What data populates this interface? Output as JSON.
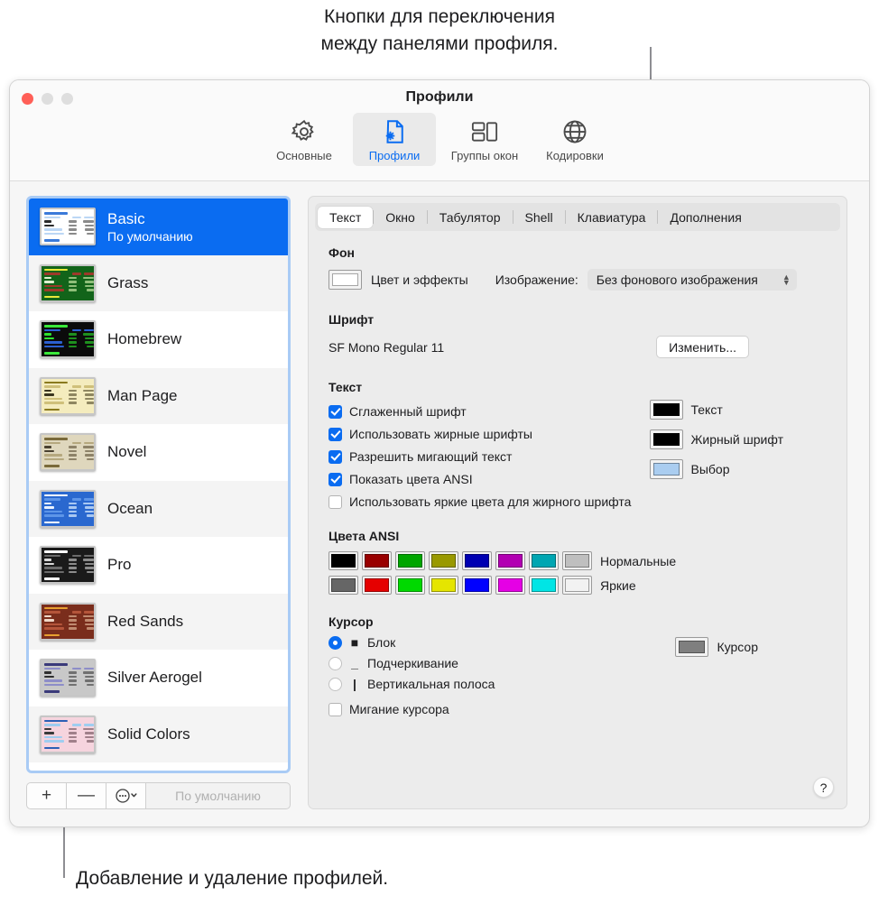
{
  "callouts": {
    "top": "Кнопки для переключения\nмежду панелями профиля.",
    "bottom": "Добавление и удаление профилей."
  },
  "window": {
    "title": "Профили",
    "traffic": {
      "close": "close-button",
      "minimize": "minimize-button",
      "zoom": "zoom-button"
    }
  },
  "toolbar": {
    "items": [
      {
        "label": "Основные",
        "icon": "gear-icon",
        "selected": false
      },
      {
        "label": "Профили",
        "icon": "document-gear-icon",
        "selected": true
      },
      {
        "label": "Группы окон",
        "icon": "window-groups-icon",
        "selected": false
      },
      {
        "label": "Кодировки",
        "icon": "globe-icon",
        "selected": false
      }
    ]
  },
  "sidebar": {
    "profiles": [
      {
        "name": "Basic",
        "subtitle": "По умолчанию",
        "selected": true,
        "theme": {
          "bg": "#ffffff",
          "fg": "#2b2b2b",
          "accent": "#3b7ad9",
          "hl": "#bcd7f5",
          "dim": "#8a8a8a"
        }
      },
      {
        "name": "Grass",
        "subtitle": "",
        "selected": false,
        "theme": {
          "bg": "#12641a",
          "fg": "#dff0cf",
          "accent": "#e8e83a",
          "hl": "#9c3a2a",
          "dim": "#8fbf7a"
        }
      },
      {
        "name": "Homebrew",
        "subtitle": "",
        "selected": false,
        "theme": {
          "bg": "#0b0b0b",
          "fg": "#2ee32e",
          "accent": "#3ae83a",
          "hl": "#2b5fd0",
          "dim": "#1e8f1e"
        }
      },
      {
        "name": "Man Page",
        "subtitle": "",
        "selected": false,
        "theme": {
          "bg": "#f4ecbe",
          "fg": "#3a3520",
          "accent": "#8a7a1e",
          "hl": "#cfc07a",
          "dim": "#8e8660"
        }
      },
      {
        "name": "Novel",
        "subtitle": "",
        "selected": false,
        "theme": {
          "bg": "#dfd7bd",
          "fg": "#4a4130",
          "accent": "#7a6a3a",
          "hl": "#b5a87e",
          "dim": "#8d8268"
        }
      },
      {
        "name": "Ocean",
        "subtitle": "",
        "selected": false,
        "theme": {
          "bg": "#2a68cf",
          "fg": "#eaf2ff",
          "accent": "#ffffff",
          "hl": "#5d95e8",
          "dim": "#a9c8f2"
        }
      },
      {
        "name": "Pro",
        "subtitle": "",
        "selected": false,
        "theme": {
          "bg": "#1a1a1a",
          "fg": "#d8d8d8",
          "accent": "#ffffff",
          "hl": "#6b6b6b",
          "dim": "#8c8c8c"
        }
      },
      {
        "name": "Red Sands",
        "subtitle": "",
        "selected": false,
        "theme": {
          "bg": "#7a2d1c",
          "fg": "#f0d8c8",
          "accent": "#e8a030",
          "hl": "#b5553a",
          "dim": "#c08a70"
        }
      },
      {
        "name": "Silver Aerogel",
        "subtitle": "",
        "selected": false,
        "theme": {
          "bg": "#c8c8c8",
          "fg": "#2f2f2f",
          "accent": "#3a3a7a",
          "hl": "#8d8dc8",
          "dim": "#707070"
        }
      },
      {
        "name": "Solid Colors",
        "subtitle": "",
        "selected": false,
        "theme": {
          "bg": "#f6d4de",
          "fg": "#3a3a3a",
          "accent": "#2b5fb5",
          "hl": "#9fcdf0",
          "dim": "#a0808a"
        }
      }
    ],
    "footer": {
      "add": "+",
      "remove": "—",
      "actions_icon": "ellipsis-circle-icon",
      "default_label": "По умолчанию"
    }
  },
  "panel": {
    "tabs": [
      {
        "label": "Текст",
        "selected": true
      },
      {
        "label": "Окно",
        "selected": false
      },
      {
        "label": "Табулятор",
        "selected": false
      },
      {
        "label": "Shell",
        "selected": false
      },
      {
        "label": "Клавиатура",
        "selected": false
      },
      {
        "label": "Дополнения",
        "selected": false
      }
    ],
    "background": {
      "heading": "Фон",
      "color_well_label": "Цвет и эффекты",
      "color_well_value": "#ffffff",
      "image_label": "Изображение:",
      "image_value": "Без фонового изображения"
    },
    "font": {
      "heading": "Шрифт",
      "value": "SF Mono Regular 11",
      "change_button": "Изменить..."
    },
    "text": {
      "heading": "Текст",
      "checkboxes": [
        {
          "label": "Сглаженный шрифт",
          "checked": true
        },
        {
          "label": "Использовать жирные шрифты",
          "checked": true
        },
        {
          "label": "Разрешить мигающий текст",
          "checked": true
        },
        {
          "label": "Показать цвета ANSI",
          "checked": true
        },
        {
          "label": "Использовать яркие цвета для жирного шрифта",
          "checked": false
        }
      ],
      "wells": [
        {
          "label": "Текст",
          "color": "#000000"
        },
        {
          "label": "Жирный шрифт",
          "color": "#000000"
        },
        {
          "label": "Выбор",
          "color": "#aacdf0"
        }
      ]
    },
    "ansi": {
      "heading": "Цвета ANSI",
      "normal_label": "Нормальные",
      "bright_label": "Яркие",
      "normal": [
        "#000000",
        "#990000",
        "#00a600",
        "#999900",
        "#0000b2",
        "#b200b2",
        "#00a6b2",
        "#bfbfbf"
      ],
      "bright": [
        "#666666",
        "#e50000",
        "#00d900",
        "#e5e500",
        "#0000ff",
        "#e500e5",
        "#00e5e5",
        "#f2f2f2"
      ]
    },
    "cursor": {
      "heading": "Курсор",
      "options": [
        {
          "label": "Блок",
          "glyph": "block-cursor-icon",
          "selected": true
        },
        {
          "label": "Подчеркивание",
          "glyph": "underline-cursor-icon",
          "selected": false
        },
        {
          "label": "Вертикальная полоса",
          "glyph": "bar-cursor-icon",
          "selected": false
        }
      ],
      "blink": {
        "label": "Мигание курсора",
        "checked": false
      },
      "well_label": "Курсор",
      "well_color": "#7f7f7f"
    },
    "help_button": "?"
  }
}
